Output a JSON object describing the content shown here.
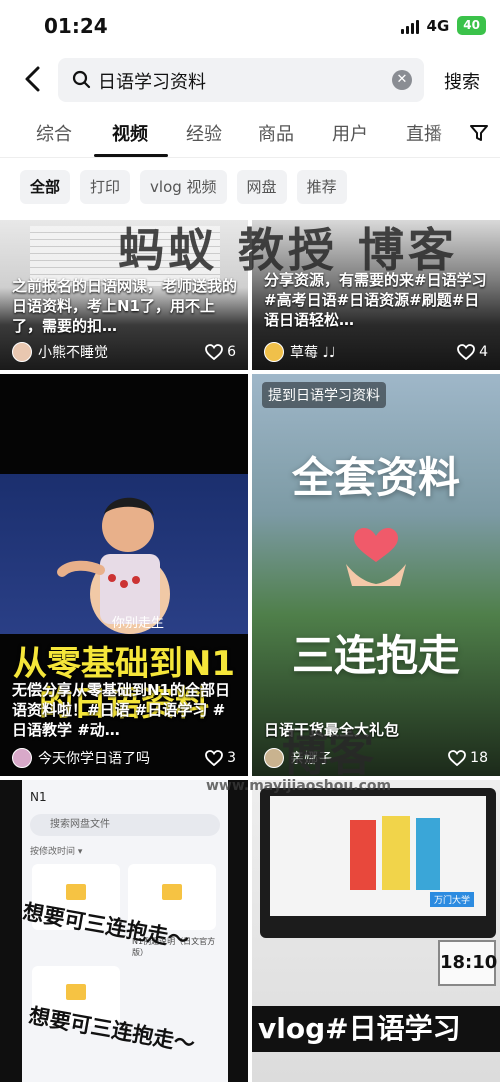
{
  "status": {
    "time": "01:24",
    "network": "4G",
    "battery": "40"
  },
  "search": {
    "query": "日语学习资料",
    "search_button": "搜索"
  },
  "tabs": [
    "综合",
    "视频",
    "经验",
    "商品",
    "用户",
    "直播"
  ],
  "chips": [
    "全部",
    "打印",
    "vlog 视频",
    "网盘",
    "推荐"
  ],
  "watermark": {
    "logo": "蚂蚁 教授 博客",
    "url": "www.mayijiaoshou.com",
    "brand": "博客"
  },
  "cards": [
    {
      "title": "之前报名的日语网课，老师送我的日语资料，考上N1了，用不上了，需要的扣…",
      "author": "小熊不睡觉",
      "likes": "6"
    },
    {
      "title": "分享资源，有需要的来#日语学习#高考日语#日语资源#刷题#日语日语轻松…",
      "author": "草莓 ♩♩",
      "likes": "4"
    },
    {
      "title": "无偿分享从零基础到N1的全部日语资料啦！#日语 #日语学习 #日语教学 #动…",
      "author": "今天你学日语了吗",
      "likes": "3",
      "big_text": "从零基础到N1的日语资料",
      "bubble": "你别走生"
    },
    {
      "title": "日语干货最全大礼包",
      "author": "亲娜子",
      "likes": "18",
      "badge": "提到日语学习资料",
      "big_top": "全套资料",
      "big_bottom": "三连抱走"
    },
    {
      "tag": "N1",
      "search_hint": "搜索网盘文件",
      "sort": "按修改时间 ▾",
      "folder_label": "N1例题说明（日文官方版）",
      "overlay_1": "想要可三连抱走～",
      "overlay_2": "想要可三连抱走～"
    },
    {
      "overlay": "vlog#日语学习",
      "clock": "18:10",
      "brand": "万门大学"
    }
  ],
  "colors": {
    "accent": "#111111",
    "battery": "#3bc24a",
    "chip_bg": "#f1f2f4",
    "big_text_yellow": "#f5e63a"
  }
}
